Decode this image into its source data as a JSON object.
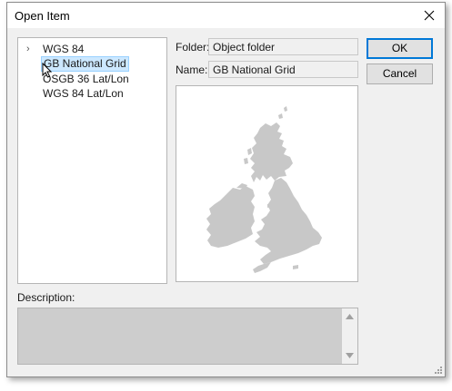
{
  "window": {
    "title": "Open Item"
  },
  "tree": {
    "items": [
      {
        "label": "WGS 84",
        "expander": "›",
        "selected": false
      },
      {
        "label": "GB National Grid",
        "expander": "",
        "selected": true
      },
      {
        "label": "OSGB 36 Lat/Lon",
        "expander": "",
        "selected": false
      },
      {
        "label": "WGS 84 Lat/Lon",
        "expander": "",
        "selected": false
      }
    ]
  },
  "form": {
    "folder_label": "Folder:",
    "folder_value": "Object folder",
    "name_label": "Name:",
    "name_value": "GB National Grid",
    "description_label": "Description:",
    "description_value": ""
  },
  "buttons": {
    "ok": "OK",
    "cancel": "Cancel"
  },
  "preview": {
    "subject": "British Isles map",
    "map_color": "#c8c8c8"
  },
  "icons": {
    "close": "close-icon",
    "expander": "chevron-right-icon",
    "cursor": "mouse-pointer-icon",
    "resize": "resize-grip-icon"
  },
  "colors": {
    "selection": "#cce8ff",
    "default_button_border": "#0078d7"
  }
}
